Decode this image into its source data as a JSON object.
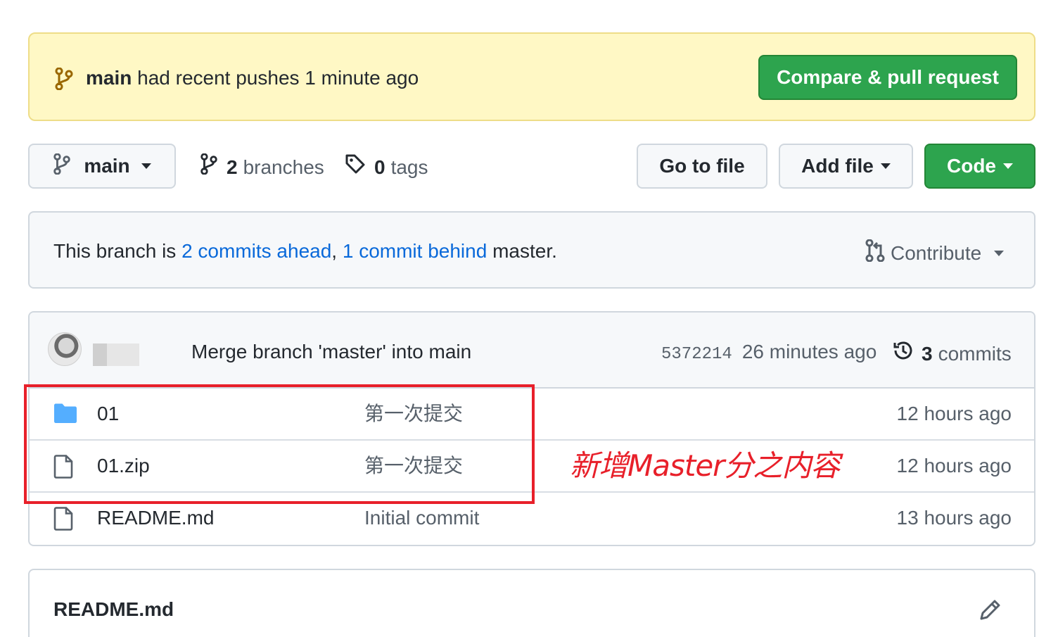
{
  "banner": {
    "branch": "main",
    "message": "had recent pushes 1 minute ago",
    "compare_button": "Compare & pull request"
  },
  "toolbar": {
    "branch": "main",
    "branches_count": "2",
    "branches_label": "branches",
    "tags_count": "0",
    "tags_label": "tags",
    "go_to_file": "Go to file",
    "add_file": "Add file",
    "code": "Code"
  },
  "compare": {
    "prefix": "This branch is",
    "ahead": "2 commits ahead",
    "comma": ",",
    "behind": "1 commit behind",
    "suffix": "master.",
    "contribute": "Contribute"
  },
  "latest_commit": {
    "message": "Merge branch 'master' into main",
    "sha": "5372214",
    "age": "26 minutes ago",
    "commits_count": "3",
    "commits_label": "commits"
  },
  "files": [
    {
      "type": "folder",
      "name": "01",
      "message": "第一次提交",
      "age": "12 hours ago"
    },
    {
      "type": "file",
      "name": "01.zip",
      "message": "第一次提交",
      "age": "12 hours ago"
    },
    {
      "type": "file",
      "name": "README.md",
      "message": "Initial commit",
      "age": "13 hours ago"
    }
  ],
  "annotation": {
    "text": "新增Master分之内容",
    "color": "#e8202a"
  },
  "readme": {
    "title": "README.md"
  },
  "colors": {
    "green": "#2da44e",
    "link": "#0969da",
    "banner_bg": "#fff8c5"
  }
}
